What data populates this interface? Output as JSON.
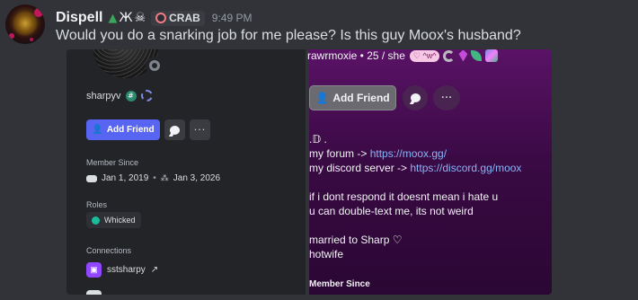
{
  "message": {
    "username": "Dispell",
    "name_decoration": "Ж",
    "tag": "CRAB",
    "timestamp": "9:49 PM",
    "text": "Would you do a snarking job for me please? Is this guy Moox's husband?"
  },
  "left_profile": {
    "username": "sharpyv",
    "add_friend_label": "Add Friend",
    "more_label": "···",
    "member_since_title": "Member Since",
    "discord_since": "Jan 1, 2019",
    "separator": "•",
    "server_since": "Jan 3, 2026",
    "roles_title": "Roles",
    "role": "Whicked",
    "role_color": "#1abc9c",
    "connections_title": "Connections",
    "connection_name": "sstsharpy",
    "connection_arrow": "↗"
  },
  "right_profile": {
    "header": "rawrmoxie • 25 / she",
    "heart_badge": "♡ ^w^",
    "add_friend_label": "Add Friend",
    "more_label": "···",
    "bio": {
      "line1": ".𝔻 .",
      "forum_prefix": "my forum -> ",
      "forum_link": "https://moox.gg/",
      "server_prefix": "my discord server -> ",
      "server_link": "https://discord.gg/moox",
      "line4": "if i dont respond it doesnt mean i hate u",
      "line5": "u can double-text me, its not weird",
      "line6": "married to Sharp ♡",
      "line7": "hotwife"
    },
    "member_since_title": "Member Since"
  },
  "colors": {
    "blurple": "#5865f2",
    "link": "#8ab4f8",
    "twitch": "#9146ff"
  }
}
